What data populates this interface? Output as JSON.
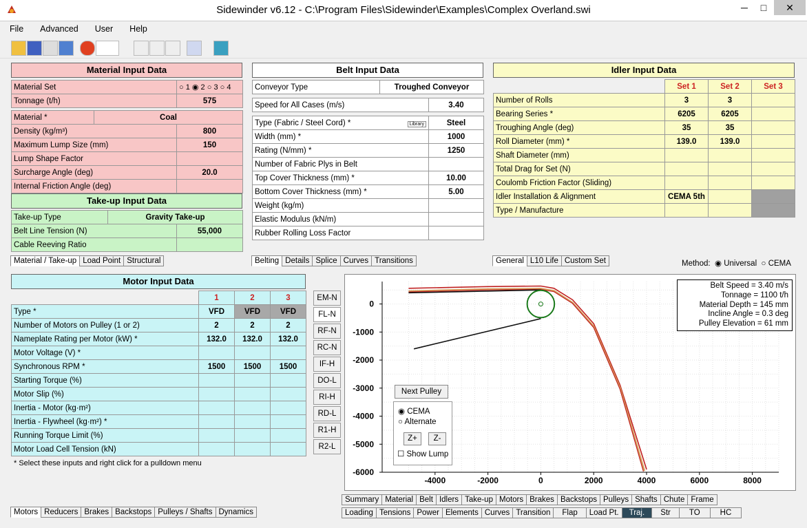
{
  "window": {
    "title": "Sidewinder v6.12 - C:\\Program Files\\Sidewinder\\Examples\\Complex Overland.swi",
    "minimize": "─",
    "maximize": "□",
    "close": "✕"
  },
  "menu": [
    "File",
    "Advanced",
    "User",
    "Help"
  ],
  "material": {
    "title": "Material Input Data",
    "rows": [
      {
        "label": "Material Set",
        "value": ""
      },
      {
        "label": "Tonnage (t/h)",
        "value": "575"
      },
      {
        "label": "Material *",
        "value": "Coal"
      },
      {
        "label": "Density (kg/m³)",
        "value": "800"
      },
      {
        "label": "Maximum Lump Size (mm)",
        "value": "150"
      },
      {
        "label": "Lump Shape Factor",
        "value": ""
      },
      {
        "label": "Surcharge Angle (deg)",
        "value": "20.0"
      },
      {
        "label": "Internal Friction Angle (deg)",
        "value": ""
      }
    ],
    "sets": [
      "1",
      "2",
      "3",
      "4"
    ]
  },
  "takeup": {
    "title": "Take-up Input Data",
    "rows": [
      {
        "label": "Take-up Type",
        "value": "Gravity Take-up"
      },
      {
        "label": "Belt Line Tension (N)",
        "value": "55,000"
      },
      {
        "label": "Cable Reeving Ratio",
        "value": ""
      }
    ]
  },
  "left_tabs": [
    "Material / Take-up",
    "Load Point",
    "Structural"
  ],
  "belt": {
    "title": "Belt Input Data",
    "conveyor_type_label": "Conveyor Type",
    "conveyor_type": "Troughed Conveyor",
    "speed_label": "Speed for All Cases (m/s)",
    "speed": "3.40",
    "library": "Library",
    "rows": [
      {
        "label": "Type (Fabric / Steel Cord) *",
        "value": "Steel"
      },
      {
        "label": "Width (mm) *",
        "value": "1000"
      },
      {
        "label": "Rating (N/mm) *",
        "value": "1250"
      },
      {
        "label": "Number of Fabric Plys in Belt",
        "value": ""
      },
      {
        "label": "Top Cover Thickness (mm) *",
        "value": "10.00"
      },
      {
        "label": "Bottom Cover Thickness (mm) *",
        "value": "5.00"
      },
      {
        "label": "Weight (kg/m)",
        "value": ""
      },
      {
        "label": "Elastic Modulus (kN/m)",
        "value": ""
      },
      {
        "label": "Rubber Rolling Loss Factor",
        "value": ""
      }
    ]
  },
  "belt_tabs": [
    "Belting",
    "Details",
    "Splice",
    "Curves",
    "Transitions"
  ],
  "idler": {
    "title": "Idler Input Data",
    "sets": [
      "Set 1",
      "Set 2",
      "Set 3"
    ],
    "rows": [
      {
        "label": "Number of Rolls",
        "s1": "3",
        "s2": "3",
        "s3": ""
      },
      {
        "label": "Bearing Series *",
        "s1": "6205",
        "s2": "6205",
        "s3": ""
      },
      {
        "label": "Troughing Angle (deg)",
        "s1": "35",
        "s2": "35",
        "s3": ""
      },
      {
        "label": "Roll Diameter (mm) *",
        "s1": "139.0",
        "s2": "139.0",
        "s3": ""
      },
      {
        "label": "Shaft Diameter (mm)",
        "s1": "",
        "s2": "",
        "s3": ""
      },
      {
        "label": "Total Drag for Set (N)",
        "s1": "",
        "s2": "",
        "s3": ""
      },
      {
        "label": "Coulomb Friction Factor (Sliding)",
        "s1": "",
        "s2": "",
        "s3": ""
      },
      {
        "label": "Idler Installation & Alignment",
        "s1": "CEMA 5th",
        "s2": "",
        "s3": ""
      },
      {
        "label": "Type / Manufacture",
        "s1": "",
        "s2": "",
        "s3": ""
      }
    ]
  },
  "idler_tabs": [
    "General",
    "L10 Life",
    "Custom Set"
  ],
  "method": {
    "label": "Method:",
    "options": [
      "Universal",
      "CEMA"
    ]
  },
  "motor": {
    "title": "Motor Input Data",
    "cols": [
      "1",
      "2",
      "3"
    ],
    "rows": [
      {
        "label": "Type *",
        "c1": "VFD",
        "c2": "VFD",
        "c3": "VFD"
      },
      {
        "label": "Number of Motors on Pulley (1 or 2)",
        "c1": "2",
        "c2": "2",
        "c3": "2"
      },
      {
        "label": "Nameplate Rating per Motor (kW) *",
        "c1": "132.0",
        "c2": "132.0",
        "c3": "132.0"
      },
      {
        "label": "Motor Voltage (V) *",
        "c1": "",
        "c2": "",
        "c3": ""
      },
      {
        "label": "Synchronous RPM *",
        "c1": "1500",
        "c2": "1500",
        "c3": "1500"
      },
      {
        "label": "Starting Torque (%)",
        "c1": "",
        "c2": "",
        "c3": ""
      },
      {
        "label": "Motor Slip (%)",
        "c1": "",
        "c2": "",
        "c3": ""
      },
      {
        "label": "Inertia - Motor (kg·m²)",
        "c1": "",
        "c2": "",
        "c3": ""
      },
      {
        "label": "Inertia - Flywheel (kg·m²) *",
        "c1": "",
        "c2": "",
        "c3": ""
      },
      {
        "label": "Running Torque Limit (%)",
        "c1": "",
        "c2": "",
        "c3": ""
      },
      {
        "label": "Motor Load Cell Tension (kN)",
        "c1": "",
        "c2": "",
        "c3": ""
      }
    ],
    "note": "* Select these inputs and right click for a pulldown menu"
  },
  "bottom_left_tabs": [
    "Motors",
    "Reducers",
    "Brakes",
    "Backstops",
    "Pulleys / Shafts",
    "Dynamics"
  ],
  "side_buttons": [
    "EM-N",
    "FL-N",
    "RF-N",
    "RC-N",
    "IF-H",
    "DO-L",
    "RI-H",
    "RD-L",
    "R1-H",
    "R2-L"
  ],
  "info_box": [
    "Belt Speed = 3.40 m/s",
    "Tonnage = 1100 t/h",
    "Material Depth = 145 mm",
    "Incline Angle = 0.3 deg",
    "Pulley Elevation = 61 mm"
  ],
  "controls": {
    "next_pulley": "Next Pulley",
    "cema": "CEMA",
    "alternate": "Alternate",
    "zplus": "Z+",
    "zminus": "Z-",
    "show_lump": "Show Lump"
  },
  "chart_data": {
    "type": "line",
    "xlim": [
      -6000,
      9000
    ],
    "ylim": [
      -6000,
      800
    ],
    "xticks": [
      -4000,
      -2000,
      0,
      2000,
      4000,
      6000,
      8000
    ],
    "yticks": [
      0,
      -1000,
      -2000,
      -3000,
      -4000,
      -5000,
      -6000
    ],
    "grid": true,
    "series": [
      {
        "values": [
          [
            -5000,
            560
          ],
          [
            -2000,
            620
          ],
          [
            0,
            640
          ],
          [
            500,
            560
          ],
          [
            1200,
            150
          ],
          [
            2000,
            -700
          ],
          [
            3000,
            -2900
          ],
          [
            4000,
            -5900
          ]
        ]
      },
      {
        "values": [
          [
            -5000,
            460
          ],
          [
            -2000,
            530
          ],
          [
            0,
            550
          ],
          [
            500,
            470
          ],
          [
            1200,
            50
          ],
          [
            2000,
            -800
          ],
          [
            3000,
            -3000
          ],
          [
            3920,
            -5950
          ]
        ]
      },
      {
        "values": [
          [
            -5000,
            430
          ],
          [
            -2000,
            500
          ],
          [
            0,
            520
          ],
          [
            500,
            440
          ],
          [
            1200,
            20
          ],
          [
            2000,
            -840
          ],
          [
            3000,
            -3050
          ],
          [
            3880,
            -5970
          ]
        ]
      },
      {
        "values": [
          [
            -5000,
            400
          ],
          [
            0,
            500
          ]
        ]
      },
      {
        "values": [
          [
            -4800,
            -1600
          ],
          [
            0,
            -520
          ]
        ]
      }
    ],
    "pulley": {
      "center": [
        0,
        0
      ],
      "radius": 500
    }
  },
  "bottom_tabs_row1": [
    "Summary",
    "Material",
    "Belt",
    "Idlers",
    "Take-up",
    "Motors",
    "Brakes",
    "Backstops",
    "Pulleys",
    "Shafts",
    "Chute",
    "Frame"
  ],
  "bottom_tabs_row2": [
    "Loading",
    "Tensions",
    "Power",
    "Elements",
    "Curves",
    "Transition",
    "Flap",
    "Load Pt.",
    "Traj.",
    "Str",
    "TO",
    "HC"
  ],
  "colors": {
    "pink": "#f8c6c6",
    "green": "#c9f3c6",
    "cyan": "#c9f4f6",
    "yellow": "#fbfbc6",
    "set_header": "#cc2222",
    "pulley": "#1a7a1a",
    "belt_red": "#c02020",
    "belt_tan": "#d6a060"
  }
}
